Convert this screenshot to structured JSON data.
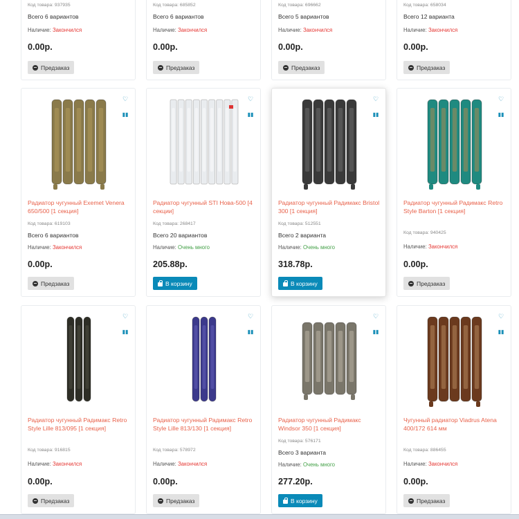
{
  "labels": {
    "code_prefix": "Код товара:",
    "availability_prefix": "Наличие:",
    "preorder": "Предзаказ",
    "to_cart": "В корзину"
  },
  "products": [
    {
      "title": "",
      "code": "937935",
      "variants": "Всего 6 вариантов",
      "status": "Закончился",
      "status_ok": false,
      "price": "0.00р.",
      "button": "preorder"
    },
    {
      "title": "",
      "code": "685852",
      "variants": "Всего 6 вариантов",
      "status": "Закончился",
      "status_ok": false,
      "price": "0.00р.",
      "button": "preorder"
    },
    {
      "title": "",
      "code": "696662",
      "variants": "Всего 5 вариантов",
      "status": "Закончился",
      "status_ok": false,
      "price": "0.00р.",
      "button": "preorder"
    },
    {
      "title": "",
      "code": "658034",
      "variants": "Всего 12 варианта",
      "status": "Закончился",
      "status_ok": false,
      "price": "0.00р.",
      "button": "preorder"
    },
    {
      "title": "Радиатор чугунный Exemet Venera 650/500 [1 секция]",
      "code": "619103",
      "variants": "Всего 6 вариантов",
      "status": "Закончился",
      "status_ok": false,
      "price": "0.00р.",
      "button": "preorder",
      "color": "#8a7a4a",
      "accent": "#b8a060"
    },
    {
      "title": "Радиатор чугунный STI Нова-500 [4 секции]",
      "code": "268417",
      "variants": "Всего 20 вариантов",
      "status": "Очень много",
      "status_ok": true,
      "price": "205.88р.",
      "button": "cart",
      "color": "#e9ecef",
      "accent": "#ffffff"
    },
    {
      "title": "Радиатор чугунный Радимакс Bristol 300 [1 секция]",
      "code": "512551",
      "variants": "Всего 2 варианта",
      "status": "Очень много",
      "status_ok": true,
      "price": "318.78р.",
      "button": "cart",
      "color": "#3a3a3a",
      "accent": "#777"
    },
    {
      "title": "Радиатор чугунный Радимакс Retro Style Barton [1 секция]",
      "code": "940425",
      "variants": "",
      "status": "Закончился",
      "status_ok": false,
      "price": "0.00р.",
      "button": "preorder",
      "color": "#1f8a80",
      "accent": "#c58a4a"
    },
    {
      "title": "Радиатор чугунный Радимакс Retro Style Lille 813/095 [1 секция]",
      "code": "916815",
      "variants": "",
      "status": "Закончился",
      "status_ok": false,
      "price": "0.00р.",
      "button": "preorder",
      "color": "#2e2e26",
      "accent": "#55554a"
    },
    {
      "title": "Радиатор чугунный Радимакс Retro Style Lille 813/130 [1 секция]",
      "code": "578972",
      "variants": "",
      "status": "Закончился",
      "status_ok": false,
      "price": "0.00р.",
      "button": "preorder",
      "color": "#3c3a8c",
      "accent": "#6a68c0"
    },
    {
      "title": "Радиатор чугунный Радимакс Windsor 350 [1 секция]",
      "code": "576171",
      "variants": "Всего 3 варианта",
      "status": "Очень много",
      "status_ok": true,
      "price": "277.20р.",
      "button": "cart",
      "color": "#7a766a",
      "accent": "#c8c2b0"
    },
    {
      "title": "Чугунный радиатор Viadrus Atena 400/172 614 мм",
      "code": "886455",
      "variants": "",
      "status": "Закончился",
      "status_ok": false,
      "price": "0.00р.",
      "button": "preorder",
      "color": "#6b3a1e",
      "accent": "#c59a6a"
    }
  ]
}
